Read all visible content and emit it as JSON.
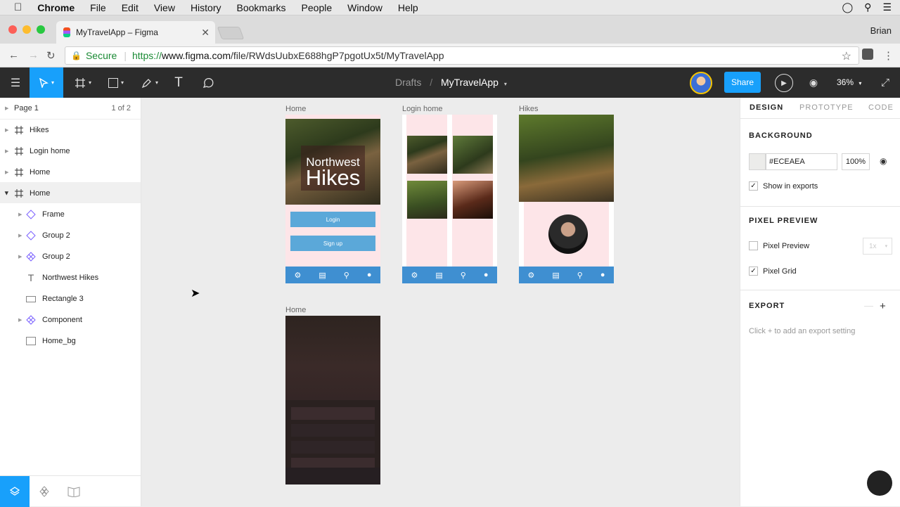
{
  "menubar": {
    "app": "Chrome",
    "items": [
      "File",
      "Edit",
      "View",
      "History",
      "Bookmarks",
      "People",
      "Window",
      "Help"
    ]
  },
  "browser": {
    "tab_title": "MyTravelApp – Figma",
    "user": "Brian",
    "secure_label": "Secure",
    "url_scheme": "https://",
    "url_domain": "www.figma.com",
    "url_path": "/file/RWdsUubxE688hgP7pgotUx5t/MyTravelApp"
  },
  "toolbar": {
    "breadcrumb_parent": "Drafts",
    "breadcrumb_file": "MyTravelApp",
    "share_label": "Share",
    "zoom": "36%"
  },
  "pages": {
    "current": "Page 1",
    "count": "1 of 2"
  },
  "layers": [
    {
      "name": "Hikes",
      "type": "frame"
    },
    {
      "name": "Login home",
      "type": "frame"
    },
    {
      "name": "Home",
      "type": "frame"
    },
    {
      "name": "Home",
      "type": "frame"
    },
    {
      "name": "Frame",
      "type": "instance"
    },
    {
      "name": "Group 2",
      "type": "instance"
    },
    {
      "name": "Group 2",
      "type": "component"
    },
    {
      "name": "Northwest Hikes",
      "type": "text"
    },
    {
      "name": "Rectangle 3",
      "type": "rect"
    },
    {
      "name": "Component",
      "type": "component"
    },
    {
      "name": "Home_bg",
      "type": "rect"
    }
  ],
  "canvas": {
    "frames": [
      {
        "label": "Home"
      },
      {
        "label": "Login home"
      },
      {
        "label": "Hikes"
      },
      {
        "label": "Home"
      }
    ],
    "hero_line1": "Northwest",
    "hero_line2": "Hikes",
    "login_label": "Login",
    "signup_label": "Sign up"
  },
  "design_panel": {
    "tabs": [
      "DESIGN",
      "PROTOTYPE",
      "CODE"
    ],
    "background_title": "BACKGROUND",
    "bg_hex": "#ECEAEA",
    "bg_opacity": "100%",
    "show_in_exports": "Show in exports",
    "pixel_preview_title": "PIXEL PREVIEW",
    "pixel_preview_label": "Pixel Preview",
    "pixel_preview_scale": "1x",
    "pixel_grid_label": "Pixel Grid",
    "export_title": "EXPORT",
    "export_hint": "Click + to add an export setting"
  },
  "colors": {
    "accent": "#18a0fb",
    "toolbar_bg": "#2c2c2c",
    "nav_blue": "#3f8fd1",
    "frame_pink": "#fde5e8"
  }
}
